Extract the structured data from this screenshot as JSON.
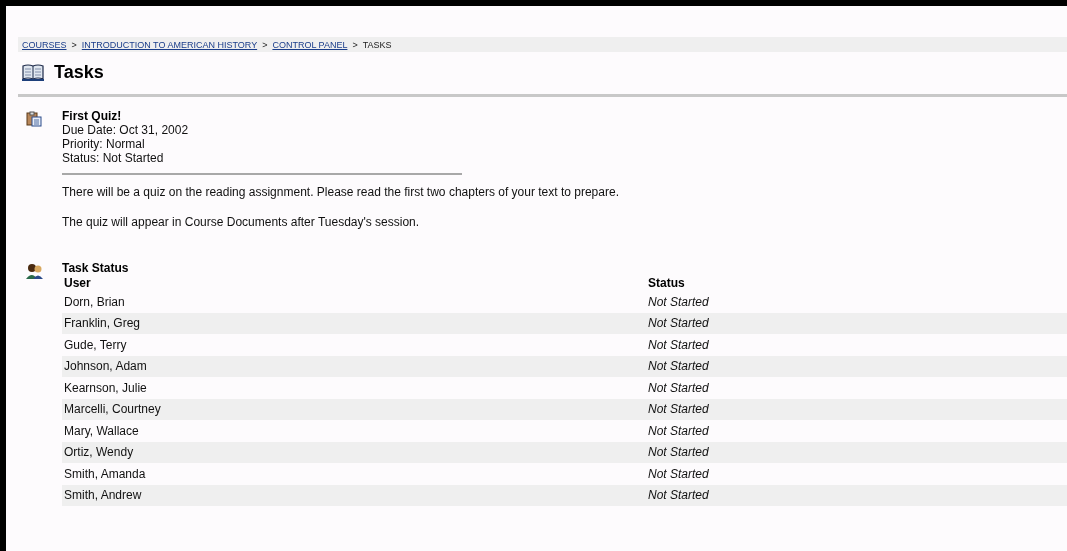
{
  "breadcrumb": [
    {
      "kind": "link",
      "label": "COURSES"
    },
    {
      "kind": "separator",
      "label": ">"
    },
    {
      "kind": "link",
      "label": "INTRODUCTION TO AMERICAN HISTORY"
    },
    {
      "kind": "separator",
      "label": ">"
    },
    {
      "kind": "link",
      "label": "CONTROL PANEL"
    },
    {
      "kind": "separator",
      "label": ">"
    },
    {
      "kind": "current",
      "label": "TASKS"
    }
  ],
  "page_title": "Tasks",
  "task": {
    "title": "First Quiz!",
    "details": [
      "Due Date: Oct 31, 2002",
      "Priority: Normal",
      "Status: Not Started"
    ],
    "description": [
      "There will be a quiz on the reading assignment. Please read the first two chapters of your text to prepare.",
      "The quiz will appear in Course Documents after Tuesday's session."
    ]
  },
  "task_status": {
    "title": "Task Status",
    "columns": [
      "User",
      "Status"
    ],
    "rows": [
      {
        "user": "Dorn, Brian",
        "status": "Not Started"
      },
      {
        "user": "Franklin, Greg",
        "status": "Not Started"
      },
      {
        "user": "Gude, Terry",
        "status": "Not Started"
      },
      {
        "user": "Johnson, Adam",
        "status": "Not Started"
      },
      {
        "user": "Kearnson, Julie",
        "status": "Not Started"
      },
      {
        "user": "Marcelli, Courtney",
        "status": "Not Started"
      },
      {
        "user": "Mary, Wallace",
        "status": "Not Started"
      },
      {
        "user": "Ortiz, Wendy",
        "status": "Not Started"
      },
      {
        "user": "Smith, Amanda",
        "status": "Not Started"
      },
      {
        "user": "Smith, Andrew",
        "status": "Not Started"
      }
    ]
  }
}
